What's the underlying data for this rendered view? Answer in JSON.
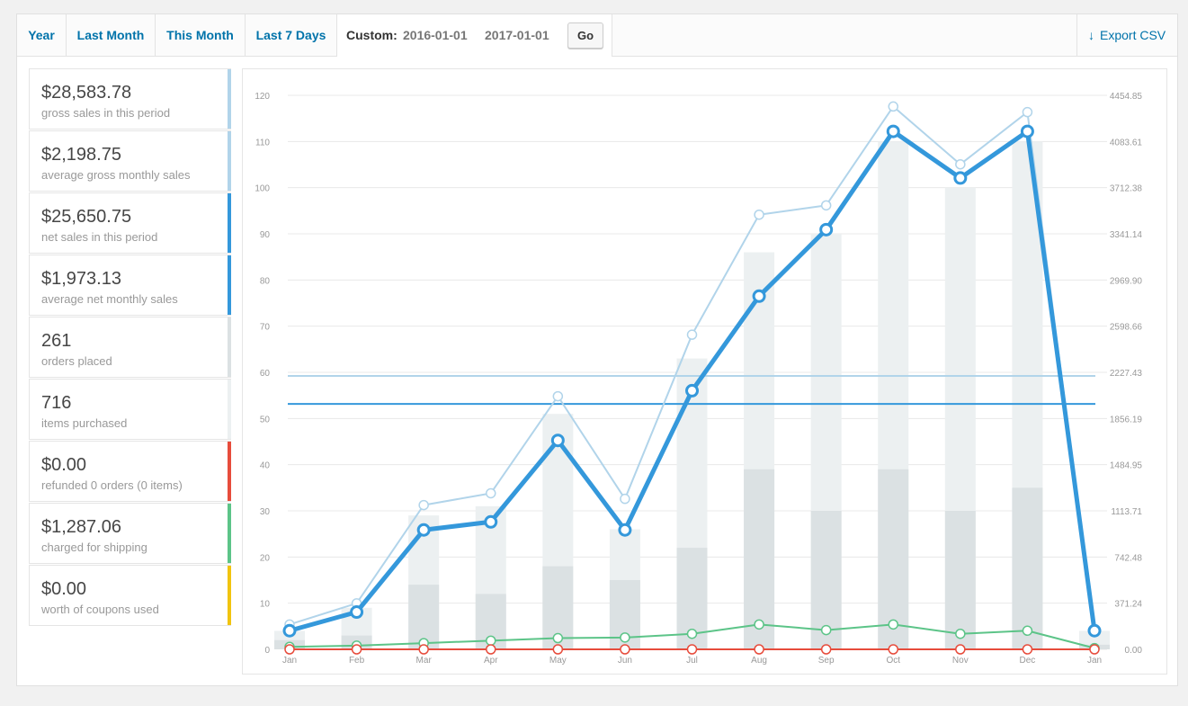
{
  "tabs": [
    {
      "label": "Year"
    },
    {
      "label": "Last Month"
    },
    {
      "label": "This Month"
    },
    {
      "label": "Last 7 Days"
    }
  ],
  "custom": {
    "label": "Custom:",
    "start_date": "2016-01-01",
    "end_date": "2017-01-01",
    "go_label": "Go"
  },
  "export": {
    "label": "Export CSV"
  },
  "legend": [
    {
      "value": "$28,583.78",
      "label": "gross sales in this period",
      "color": "#b1d4ea"
    },
    {
      "value": "$2,198.75",
      "label": "average gross monthly sales",
      "color": "#b1d4ea"
    },
    {
      "value": "$25,650.75",
      "label": "net sales in this period",
      "color": "#3498db"
    },
    {
      "value": "$1,973.13",
      "label": "average net monthly sales",
      "color": "#3498db"
    },
    {
      "value": "261",
      "label": "orders placed",
      "color": "#dbe1e3"
    },
    {
      "value": "716",
      "label": "items purchased",
      "color": "#ecf0f1"
    },
    {
      "value": "$0.00",
      "label": "refunded 0 orders (0 items)",
      "color": "#e74c3c"
    },
    {
      "value": "$1,287.06",
      "label": "charged for shipping",
      "color": "#5cc488"
    },
    {
      "value": "$0.00",
      "label": "worth of coupons used",
      "color": "#f1c40f"
    }
  ],
  "chart_data": {
    "type": "bar",
    "categories": [
      "Jan",
      "Feb",
      "Mar",
      "Apr",
      "May",
      "Jun",
      "Jul",
      "Aug",
      "Sep",
      "Oct",
      "Nov",
      "Dec",
      "Jan"
    ],
    "y_left": {
      "ticks": [
        "0",
        "10",
        "20",
        "30",
        "40",
        "50",
        "60",
        "70",
        "80",
        "90",
        "100",
        "110",
        "120"
      ],
      "range": [
        0,
        120
      ]
    },
    "y_right": {
      "ticks": [
        "0.00",
        "371.24",
        "742.48",
        "1113.71",
        "1484.95",
        "1856.19",
        "2227.43",
        "2598.66",
        "2969.90",
        "3341.14",
        "3712.38",
        "4083.61",
        "4454.85"
      ],
      "range": [
        0,
        4454.85
      ]
    },
    "series": [
      {
        "name": "items purchased",
        "kind": "bar",
        "axis": "left",
        "color": "#ecf0f1",
        "values": [
          4,
          9,
          29,
          31,
          51,
          26,
          63,
          86,
          90,
          110,
          100,
          110,
          4
        ]
      },
      {
        "name": "orders placed",
        "kind": "bar",
        "axis": "left",
        "color": "#dbe1e3",
        "values": [
          2,
          3,
          14,
          12,
          18,
          15,
          22,
          39,
          30,
          39,
          30,
          35,
          1
        ]
      },
      {
        "name": "gross sales",
        "kind": "line",
        "axis": "right",
        "color": "#b1d4ea",
        "values": [
          200,
          370,
          1160,
          1255,
          2035,
          1210,
          2530,
          3495,
          3570,
          4365,
          3900,
          4320,
          150
        ]
      },
      {
        "name": "net sales",
        "kind": "line",
        "axis": "right",
        "color": "#3498db",
        "values": [
          150,
          300,
          960,
          1025,
          1680,
          960,
          2080,
          2840,
          3375,
          4165,
          3790,
          4165,
          150
        ]
      },
      {
        "name": "shipping",
        "kind": "line",
        "axis": "right",
        "color": "#5cc488",
        "values": [
          20,
          30,
          50,
          70,
          90,
          95,
          125,
          200,
          155,
          200,
          125,
          150,
          10
        ]
      },
      {
        "name": "refunds",
        "kind": "line",
        "axis": "right",
        "color": "#e74c3c",
        "values": [
          0,
          0,
          0,
          0,
          0,
          0,
          0,
          0,
          0,
          0,
          0,
          0,
          0
        ]
      }
    ],
    "reference_lines": [
      {
        "name": "average gross monthly sales",
        "value": 2198.75,
        "axis": "right",
        "color": "#b1d4ea"
      },
      {
        "name": "average net monthly sales",
        "value": 1973.13,
        "axis": "right",
        "color": "#3498db"
      }
    ]
  }
}
